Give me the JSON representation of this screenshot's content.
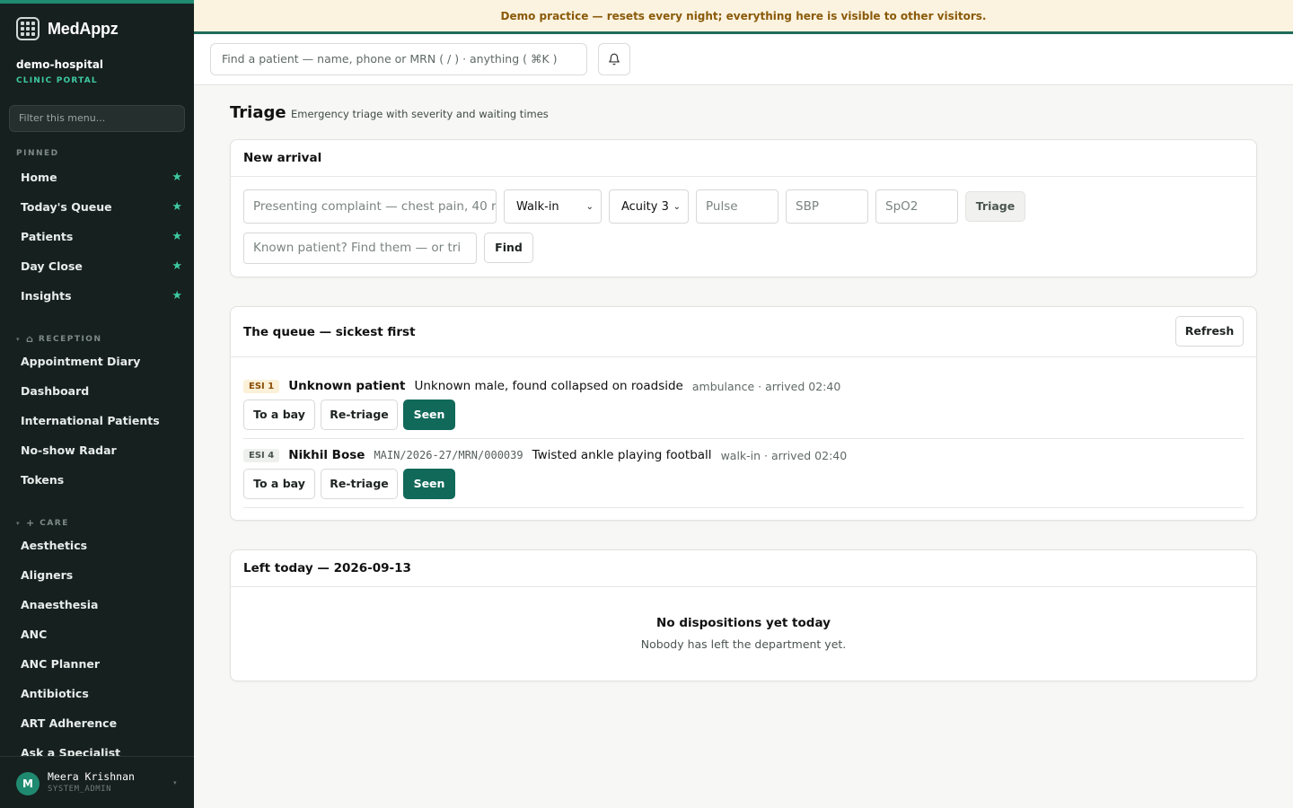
{
  "app": {
    "name": "MedAppz",
    "org": "demo-hospital",
    "org_sub": "CLINIC PORTAL"
  },
  "banner": "Demo practice — resets every night; everything here is visible to other visitors.",
  "sidebar": {
    "filter_placeholder": "Filter this menu...",
    "pinned_label": "PINNED",
    "pinned": [
      {
        "label": "Home"
      },
      {
        "label": "Today's Queue"
      },
      {
        "label": "Patients"
      },
      {
        "label": "Day Close"
      },
      {
        "label": "Insights"
      }
    ],
    "reception_label": "RECEPTION",
    "reception": [
      {
        "label": "Appointment Diary"
      },
      {
        "label": "Dashboard"
      },
      {
        "label": "International Patients"
      },
      {
        "label": "No-show Radar"
      },
      {
        "label": "Tokens"
      }
    ],
    "care_label": "CARE",
    "care": [
      {
        "label": "Aesthetics"
      },
      {
        "label": "Aligners"
      },
      {
        "label": "Anaesthesia"
      },
      {
        "label": "ANC"
      },
      {
        "label": "ANC Planner"
      },
      {
        "label": "Antibiotics"
      },
      {
        "label": "ART Adherence"
      },
      {
        "label": "Ask a Specialist"
      }
    ],
    "user": {
      "initial": "M",
      "name": "Meera Krishnan",
      "role": "SYSTEM_ADMIN"
    }
  },
  "topbar": {
    "search_placeholder": "Find a patient — name, phone or MRN ( / ) · anything ( ⌘K )"
  },
  "page": {
    "title": "Triage",
    "subtitle": "Emergency triage with severity and waiting times"
  },
  "new_arrival": {
    "title": "New arrival",
    "complaint_placeholder": "Presenting complaint — chest pain, 40 r",
    "mode": "Walk-in",
    "acuity": "Acuity 3",
    "pulse_placeholder": "Pulse",
    "sbp_placeholder": "SBP",
    "spo2_placeholder": "SpO2",
    "triage_button": "Triage",
    "known_placeholder": "Known patient? Find them — or tri",
    "find_button": "Find"
  },
  "queue": {
    "title": "The queue — sickest first",
    "refresh_button": "Refresh",
    "actions": {
      "bay": "To a bay",
      "retriage": "Re-triage",
      "seen": "Seen"
    },
    "rows": [
      {
        "esi": "ESI 1",
        "name": "Unknown patient",
        "mrn": "",
        "complaint": "Unknown male, found collapsed on roadside",
        "meta": "ambulance · arrived 02:40"
      },
      {
        "esi": "ESI 4",
        "name": "Nikhil Bose",
        "mrn": "MAIN/2026-27/MRN/000039",
        "complaint": "Twisted ankle playing football",
        "meta": "walk-in · arrived 02:40"
      }
    ]
  },
  "left_today": {
    "title": "Left today — 2026-09-13",
    "empty_title": "No dispositions yet today",
    "empty_sub": "Nobody has left the department yet."
  },
  "colors": {
    "accent": "#11695a",
    "sidebar_bg": "#16201e",
    "star": "#3ec9a2",
    "banner_bg": "#fbf3df",
    "banner_text": "#8a5a0a"
  }
}
